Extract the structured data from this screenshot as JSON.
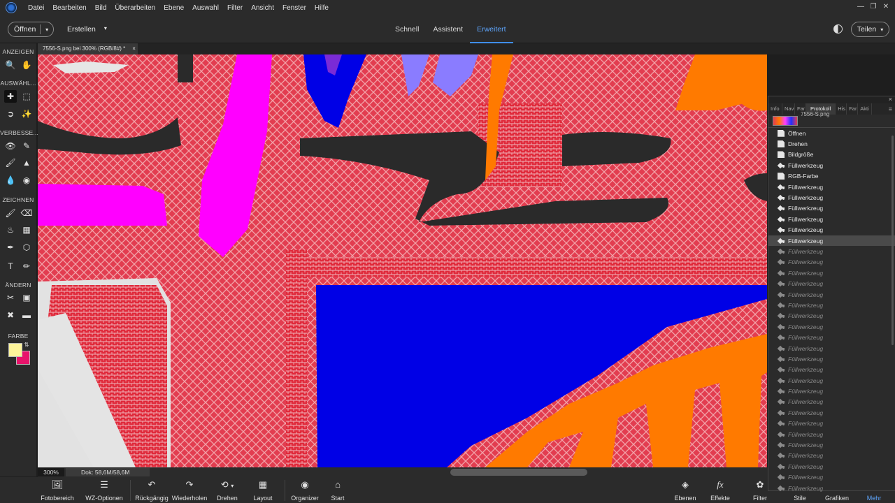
{
  "menubar": {
    "items": [
      "Datei",
      "Bearbeiten",
      "Bild",
      "Überarbeiten",
      "Ebene",
      "Auswahl",
      "Filter",
      "Ansicht",
      "Fenster",
      "Hilfe"
    ]
  },
  "topbar": {
    "open_label": "Öffnen",
    "create_label": "Erstellen",
    "tabs": [
      "Schnell",
      "Assistent",
      "Erweitert"
    ],
    "active_tab": "Erweitert",
    "share_label": "Teilen"
  },
  "toolbox": {
    "sections": {
      "view": "ANZEIGEN",
      "select": "AUSWÄHL...",
      "enhance": "VERBESSE...",
      "draw": "ZEICHNEN",
      "modify": "ÄNDERN",
      "color": "FARBE"
    },
    "foreground_color": "#fdf49a",
    "background_color": "#e8146b"
  },
  "document": {
    "tab_title": "7556-S.png bei 300% (RGB/8#) *",
    "zoom": "300%",
    "doc_info": "Dok: 58,6M/58,6M"
  },
  "history_panel": {
    "tabs": [
      "Info",
      "Navi",
      "Far",
      "Protokoll",
      "His",
      "Far",
      "Akti"
    ],
    "active_tab": "Protokoll",
    "thumb_name": "7556-S.png",
    "steps": [
      {
        "label": "Öffnen",
        "icon": "doc",
        "state": "done"
      },
      {
        "label": "Drehen",
        "icon": "doc",
        "state": "done"
      },
      {
        "label": "Bildgröße",
        "icon": "doc",
        "state": "done"
      },
      {
        "label": "Füllwerkzeug",
        "icon": "bucket",
        "state": "done"
      },
      {
        "label": "RGB-Farbe",
        "icon": "doc",
        "state": "done"
      },
      {
        "label": "Füllwerkzeug",
        "icon": "bucket",
        "state": "done"
      },
      {
        "label": "Füllwerkzeug",
        "icon": "bucket",
        "state": "done"
      },
      {
        "label": "Füllwerkzeug",
        "icon": "bucket",
        "state": "done"
      },
      {
        "label": "Füllwerkzeug",
        "icon": "bucket",
        "state": "done"
      },
      {
        "label": "Füllwerkzeug",
        "icon": "bucket",
        "state": "done"
      },
      {
        "label": "Füllwerkzeug",
        "icon": "bucket",
        "state": "selected"
      },
      {
        "label": "Füllwerkzeug",
        "icon": "bucket",
        "state": "undone"
      },
      {
        "label": "Füllwerkzeug",
        "icon": "bucket",
        "state": "undone"
      },
      {
        "label": "Füllwerkzeug",
        "icon": "bucket",
        "state": "undone"
      },
      {
        "label": "Füllwerkzeug",
        "icon": "bucket",
        "state": "undone"
      },
      {
        "label": "Füllwerkzeug",
        "icon": "bucket",
        "state": "undone"
      },
      {
        "label": "Füllwerkzeug",
        "icon": "bucket",
        "state": "undone"
      },
      {
        "label": "Füllwerkzeug",
        "icon": "bucket",
        "state": "undone"
      },
      {
        "label": "Füllwerkzeug",
        "icon": "bucket",
        "state": "undone"
      },
      {
        "label": "Füllwerkzeug",
        "icon": "bucket",
        "state": "undone"
      },
      {
        "label": "Füllwerkzeug",
        "icon": "bucket",
        "state": "undone"
      },
      {
        "label": "Füllwerkzeug",
        "icon": "bucket",
        "state": "undone"
      },
      {
        "label": "Füllwerkzeug",
        "icon": "bucket",
        "state": "undone"
      },
      {
        "label": "Füllwerkzeug",
        "icon": "bucket",
        "state": "undone"
      },
      {
        "label": "Füllwerkzeug",
        "icon": "bucket",
        "state": "undone"
      },
      {
        "label": "Füllwerkzeug",
        "icon": "bucket",
        "state": "undone"
      },
      {
        "label": "Füllwerkzeug",
        "icon": "bucket",
        "state": "undone"
      },
      {
        "label": "Füllwerkzeug",
        "icon": "bucket",
        "state": "undone"
      },
      {
        "label": "Füllwerkzeug",
        "icon": "bucket",
        "state": "undone"
      },
      {
        "label": "Füllwerkzeug",
        "icon": "bucket",
        "state": "undone"
      },
      {
        "label": "Füllwerkzeug",
        "icon": "bucket",
        "state": "undone"
      },
      {
        "label": "Füllwerkzeug",
        "icon": "bucket",
        "state": "undone"
      },
      {
        "label": "Füllwerkzeug",
        "icon": "bucket",
        "state": "undone"
      },
      {
        "label": "Füllwerkzeug",
        "icon": "bucket",
        "state": "undone"
      }
    ]
  },
  "bottombar": {
    "photo_bin": "Fotobereich",
    "tool_options": "WZ-Optionen",
    "undo": "Rückgängig",
    "redo": "Wiederholen",
    "rotate": "Drehen",
    "layout": "Layout",
    "organizer": "Organizer",
    "start": "Start",
    "layers": "Ebenen",
    "effects": "Effekte",
    "filters": "Filter",
    "styles": "Stile",
    "graphics": "Grafiken",
    "more": "Mehr"
  },
  "colors": {
    "accent": "#3f8ef5",
    "canvas_red": "#e23d50",
    "canvas_orange": "#ff7a00",
    "canvas_magenta": "#ff00ff",
    "canvas_blue": "#0000e6",
    "canvas_dark": "#2a2a2a"
  }
}
